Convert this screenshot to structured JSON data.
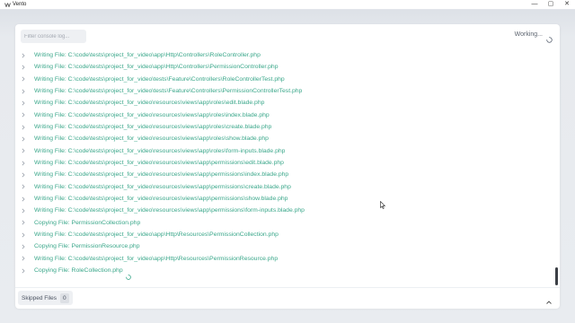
{
  "window": {
    "title": "Vento",
    "controls": {
      "minimize": "—",
      "maximize": "▢",
      "close": "✕"
    }
  },
  "toolbar": {
    "filter_placeholder": "Filter console log...",
    "filter_value": "",
    "status": "Working..."
  },
  "log": [
    {
      "text": "Writing File: C:\\code\\tests\\project_for_video\\app\\Http\\Controllers\\RoleController.php"
    },
    {
      "text": "Writing File: C:\\code\\tests\\project_for_video\\app\\Http\\Controllers\\PermissionController.php"
    },
    {
      "text": "Writing File: C:\\code\\tests\\project_for_video\\tests\\Feature\\Controllers\\RoleControllerTest.php"
    },
    {
      "text": "Writing File: C:\\code\\tests\\project_for_video\\tests\\Feature\\Controllers\\PermissionControllerTest.php"
    },
    {
      "text": "Writing File: C:\\code\\tests\\project_for_video\\resources\\views\\app\\roles\\edit.blade.php"
    },
    {
      "text": "Writing File: C:\\code\\tests\\project_for_video\\resources\\views\\app\\roles\\index.blade.php"
    },
    {
      "text": "Writing File: C:\\code\\tests\\project_for_video\\resources\\views\\app\\roles\\create.blade.php"
    },
    {
      "text": "Writing File: C:\\code\\tests\\project_for_video\\resources\\views\\app\\roles\\show.blade.php"
    },
    {
      "text": "Writing File: C:\\code\\tests\\project_for_video\\resources\\views\\app\\roles\\form-inputs.blade.php"
    },
    {
      "text": "Writing File: C:\\code\\tests\\project_for_video\\resources\\views\\app\\permissions\\edit.blade.php"
    },
    {
      "text": "Writing File: C:\\code\\tests\\project_for_video\\resources\\views\\app\\permissions\\index.blade.php"
    },
    {
      "text": "Writing File: C:\\code\\tests\\project_for_video\\resources\\views\\app\\permissions\\create.blade.php"
    },
    {
      "text": "Writing File: C:\\code\\tests\\project_for_video\\resources\\views\\app\\permissions\\show.blade.php"
    },
    {
      "text": "Writing File: C:\\code\\tests\\project_for_video\\resources\\views\\app\\permissions\\form-inputs.blade.php"
    },
    {
      "text": "Copying File: PermissionCollection.php"
    },
    {
      "text": "Writing File: C:\\code\\tests\\project_for_video\\app\\Http\\Resources\\PermissionCollection.php"
    },
    {
      "text": "Copying File: PermissionResource.php"
    },
    {
      "text": "Writing File: C:\\code\\tests\\project_for_video\\app\\Http\\Resources\\PermissionResource.php"
    },
    {
      "text": "Copying File: RoleCollection.php",
      "in_progress": true
    }
  ],
  "footer": {
    "skipped_label": "Skipped Files",
    "skipped_count": "0"
  },
  "colors": {
    "log_text": "#3aa78a",
    "background": "#e9ecf0",
    "panel": "#ffffff"
  },
  "icons": {
    "app": "vento-logo-icon",
    "status_spinner": "spinner-icon",
    "row_chevron": "chevron-right-icon",
    "collapse": "chevron-up-icon"
  }
}
